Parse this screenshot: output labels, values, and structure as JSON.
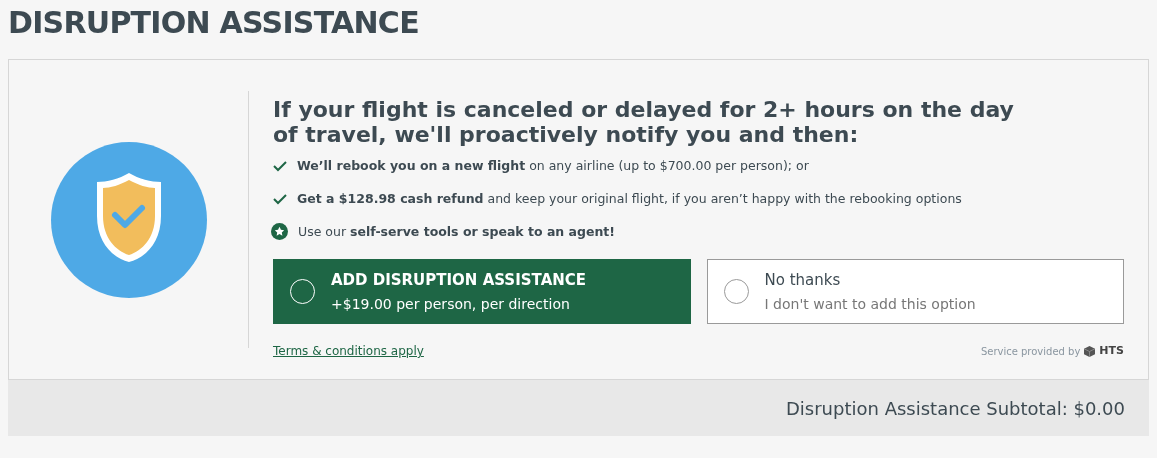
{
  "title": "DISRUPTION ASSISTANCE",
  "headline": "If your flight is canceled or delayed for 2+ hours on the day of travel, we'll proactively notify you and then:",
  "benefits": [
    {
      "kind": "check",
      "text": "**We’ll rebook you on a new flight** on any airline (up to $700.00 per person); or"
    },
    {
      "kind": "check",
      "text": "**Get a $128.98 cash refund** and keep your original flight, if you aren’t happy with the rebooking options"
    },
    {
      "kind": "star",
      "text": "Use our **self-serve tools or speak to an agent!**"
    }
  ],
  "options": [
    {
      "kind": "primary",
      "selected": false,
      "title": "ADD DISRUPTION ASSISTANCE",
      "subtitle": "+$19.00 per person, per direction"
    },
    {
      "kind": "secondary",
      "selected": false,
      "title": "No thanks",
      "subtitle": "I don't want to add this option"
    }
  ],
  "terms_link": "Terms & conditions apply",
  "provider": {
    "label": "Service provided by",
    "brand": "HTS"
  },
  "subtotal": "Disruption Assistance Subtotal: $0.00"
}
